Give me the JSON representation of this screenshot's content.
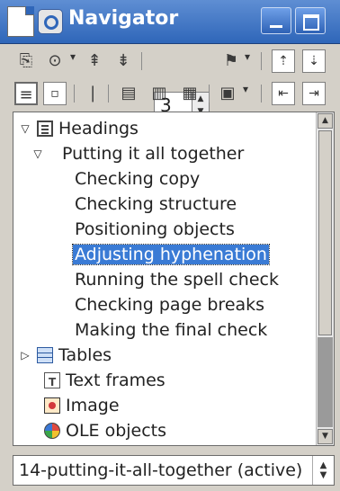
{
  "window": {
    "title": "Navigator"
  },
  "toolbar": {
    "headings_level": "3"
  },
  "tree": {
    "headings_label": "Headings",
    "chapter_label": "Putting it all together",
    "items": [
      "Checking copy",
      "Checking structure",
      "Positioning objects",
      "Adjusting hyphenation",
      "Running the spell check",
      "Checking page breaks",
      "Making the final check"
    ],
    "tables_label": "Tables",
    "text_frames_label": "Text frames",
    "image_label": "Image",
    "ole_label": "OLE objects"
  },
  "document_select": {
    "value": "14-putting-it-all-together (active)"
  },
  "colors": {
    "title_bar": "#2f66b9",
    "selection": "#3a7bd5"
  }
}
